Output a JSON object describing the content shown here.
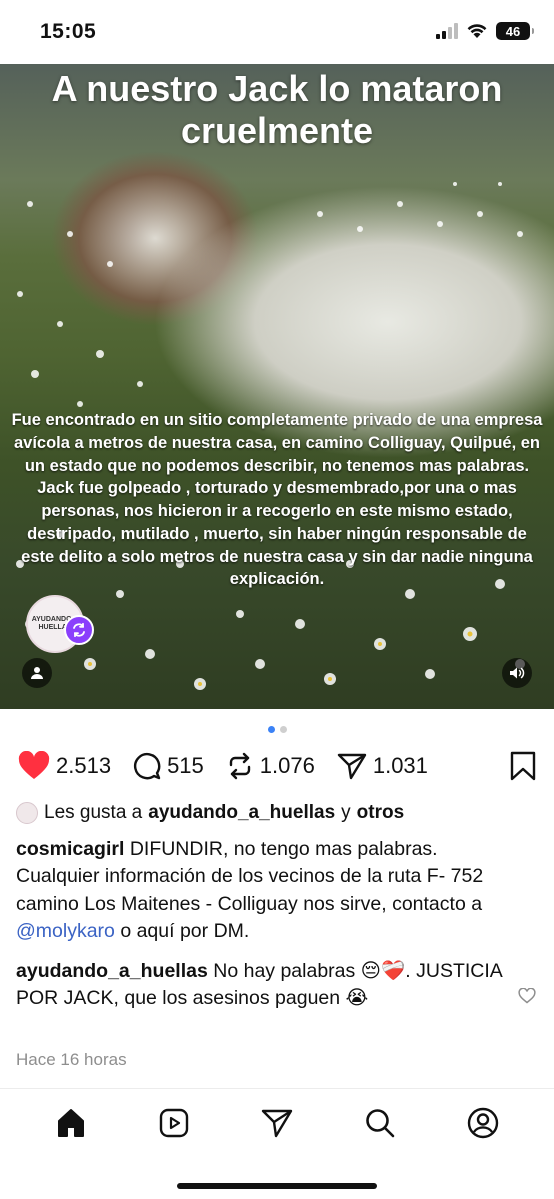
{
  "status_bar": {
    "time": "15:05",
    "battery": "46"
  },
  "post": {
    "title": "A nuestro Jack lo mataron cruelmente",
    "body_paragraphs": [
      "Fue encontrado en un sitio completamente privado de una empresa avícola a metros de nuestra casa, en camino Colliguay, Quilpué, en un estado que no podemos describir, no tenemos mas palabras.",
      "Jack fue golpeado , torturado y desmembrado,por una o mas personas, nos hicieron ir a recogerlo en este mismo estado, destripado, mutilado , muerto, sin haber ningún responsable de este delito a solo metros de nuestra casa y sin dar nadie ninguna explicación."
    ],
    "sticker_text": "AYUDANDO A HUELLAS",
    "page_count": 2,
    "active_page": 1
  },
  "actions": {
    "likes": "2.513",
    "comments": "515",
    "reposts": "1.076",
    "shares": "1.031"
  },
  "liked_by": {
    "prefix": "Les gusta a",
    "user": "ayudando_a_huellas",
    "connector": "y",
    "others": "otros"
  },
  "caption": {
    "username": "cosmicagirl",
    "text_before": "DIFUNDIR, no tengo mas palabras. Cualquier información de los vecinos de la ruta F- 752 camino Los Maitenes - Colliguay nos sirve, contacto a",
    "mention": "@molykaro",
    "text_after": "o aquí por DM."
  },
  "comment": {
    "username": "ayudando_a_huellas",
    "text": "No hay palabras 😔❤️‍🩹. JUSTICIA POR JACK, que los asesinos paguen 😭"
  },
  "timestamp": "Hace 16 horas",
  "colors": {
    "like_red": "#ff3040",
    "mention_blue": "#3b63c4",
    "pager_active": "#3b82f6",
    "sticker_badge": "#8a3ffc"
  },
  "bottom_nav": [
    "home-icon",
    "reels-icon",
    "send-icon",
    "search-icon",
    "profile-icon"
  ]
}
